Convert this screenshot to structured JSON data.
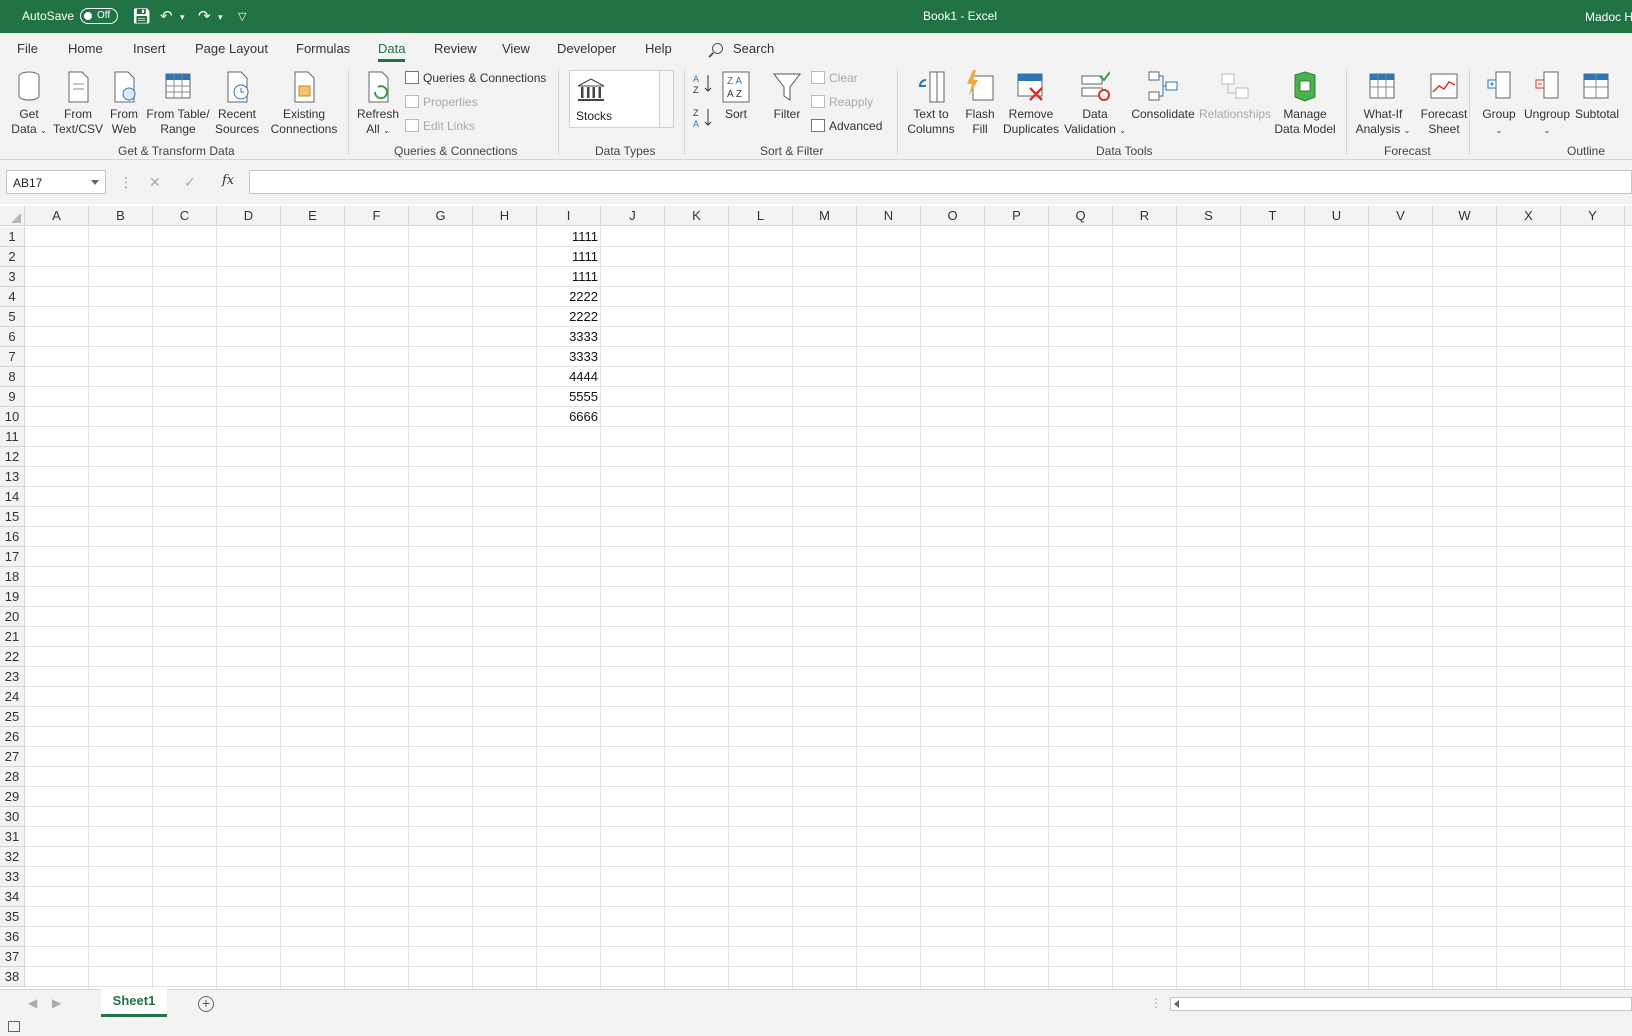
{
  "titlebar": {
    "autosave_label": "AutoSave",
    "autosave_state": "Off",
    "doc_title": "Book1  -  Excel",
    "user": "Madoc H"
  },
  "menu_tabs": [
    "File",
    "Home",
    "Insert",
    "Page Layout",
    "Formulas",
    "Data",
    "Review",
    "View",
    "Developer",
    "Help"
  ],
  "active_tab": "Data",
  "search_label": "Search",
  "ribbon": {
    "get_transform": {
      "group_label": "Get & Transform Data",
      "get_data": [
        "Get",
        "Data"
      ],
      "from_text": [
        "From",
        "Text/CSV"
      ],
      "from_web": [
        "From",
        "Web"
      ],
      "from_table": [
        "From Table/",
        "Range"
      ],
      "recent_sources": [
        "Recent",
        "Sources"
      ],
      "existing_connections": [
        "Existing",
        "Connections"
      ]
    },
    "queries": {
      "group_label": "Queries & Connections",
      "refresh_all": [
        "Refresh",
        "All"
      ],
      "queries_connections": "Queries & Connections",
      "properties": "Properties",
      "edit_links": "Edit Links"
    },
    "data_types": {
      "group_label": "Data Types",
      "stocks": "Stocks"
    },
    "sort_filter": {
      "group_label": "Sort & Filter",
      "sort": "Sort",
      "filter": "Filter",
      "clear": "Clear",
      "reapply": "Reapply",
      "advanced": "Advanced"
    },
    "data_tools": {
      "group_label": "Data Tools",
      "text_to_columns": [
        "Text to",
        "Columns"
      ],
      "flash_fill": [
        "Flash",
        "Fill"
      ],
      "remove_duplicates": [
        "Remove",
        "Duplicates"
      ],
      "data_validation": [
        "Data",
        "Validation"
      ],
      "consolidate": "Consolidate",
      "relationships": "Relationships",
      "manage_data_model": [
        "Manage",
        "Data Model"
      ]
    },
    "forecast": {
      "group_label": "Forecast",
      "what_if": [
        "What-If",
        "Analysis"
      ],
      "forecast_sheet": [
        "Forecast",
        "Sheet"
      ]
    },
    "outline": {
      "group_label": "Outline",
      "group": "Group",
      "ungroup": "Ungroup",
      "subtotal": "Subtotal"
    }
  },
  "formula_bar": {
    "name_box": "AB17",
    "fx": "fx",
    "formula": ""
  },
  "columns": [
    "A",
    "B",
    "C",
    "D",
    "E",
    "F",
    "G",
    "H",
    "I",
    "J",
    "K",
    "L",
    "M",
    "N",
    "O",
    "P",
    "Q",
    "R",
    "S",
    "T",
    "U",
    "V",
    "W",
    "X",
    "Y"
  ],
  "rows": [
    "1",
    "2",
    "3",
    "4",
    "5",
    "6",
    "7",
    "8",
    "9",
    "10",
    "11",
    "12",
    "13",
    "14",
    "15",
    "16",
    "17",
    "18",
    "19",
    "20",
    "21",
    "22",
    "23",
    "24",
    "25",
    "26",
    "27",
    "28",
    "29",
    "30",
    "31",
    "32",
    "33",
    "34",
    "35",
    "36",
    "37",
    "38"
  ],
  "cells": [
    {
      "col": "I",
      "row": 1,
      "value": "1111"
    },
    {
      "col": "I",
      "row": 2,
      "value": "1111"
    },
    {
      "col": "I",
      "row": 3,
      "value": "1111"
    },
    {
      "col": "I",
      "row": 4,
      "value": "2222"
    },
    {
      "col": "I",
      "row": 5,
      "value": "2222"
    },
    {
      "col": "I",
      "row": 6,
      "value": "3333"
    },
    {
      "col": "I",
      "row": 7,
      "value": "3333"
    },
    {
      "col": "I",
      "row": 8,
      "value": "4444"
    },
    {
      "col": "I",
      "row": 9,
      "value": "5555"
    },
    {
      "col": "I",
      "row": 10,
      "value": "6666"
    }
  ],
  "sheet_tabs": [
    "Sheet1"
  ],
  "colors": {
    "accent": "#217346",
    "ribbon_bg": "#f3f3f3",
    "gridline": "#e2e2e2"
  }
}
